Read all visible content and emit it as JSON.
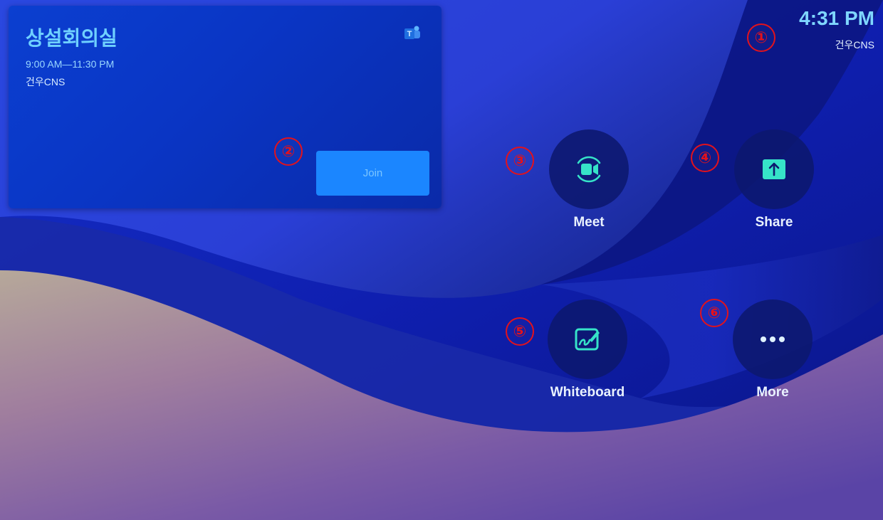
{
  "colors": {
    "accent": "#1b86ff",
    "room_title": "#6fd0ff",
    "clock": "#7fd6ff",
    "button_circle": "#0d186e",
    "annotation_red": "#e3121c"
  },
  "meeting_card": {
    "room_name": "상설회의실",
    "time_range": "9:00 AM—11:30 PM",
    "organizer": "건우CNS",
    "app_icon": "teams-icon",
    "join_label": "Join"
  },
  "status": {
    "clock": "4:31 PM",
    "org": "건우CNS"
  },
  "actions": [
    {
      "label": "Meet",
      "icon": "video-camera-icon"
    },
    {
      "label": "Share",
      "icon": "share-upload-icon"
    },
    {
      "label": "Whiteboard",
      "icon": "whiteboard-icon"
    },
    {
      "label": "More",
      "icon": "more-dots-icon"
    }
  ],
  "annotations": [
    "①",
    "②",
    "③",
    "④",
    "⑤",
    "⑥"
  ]
}
